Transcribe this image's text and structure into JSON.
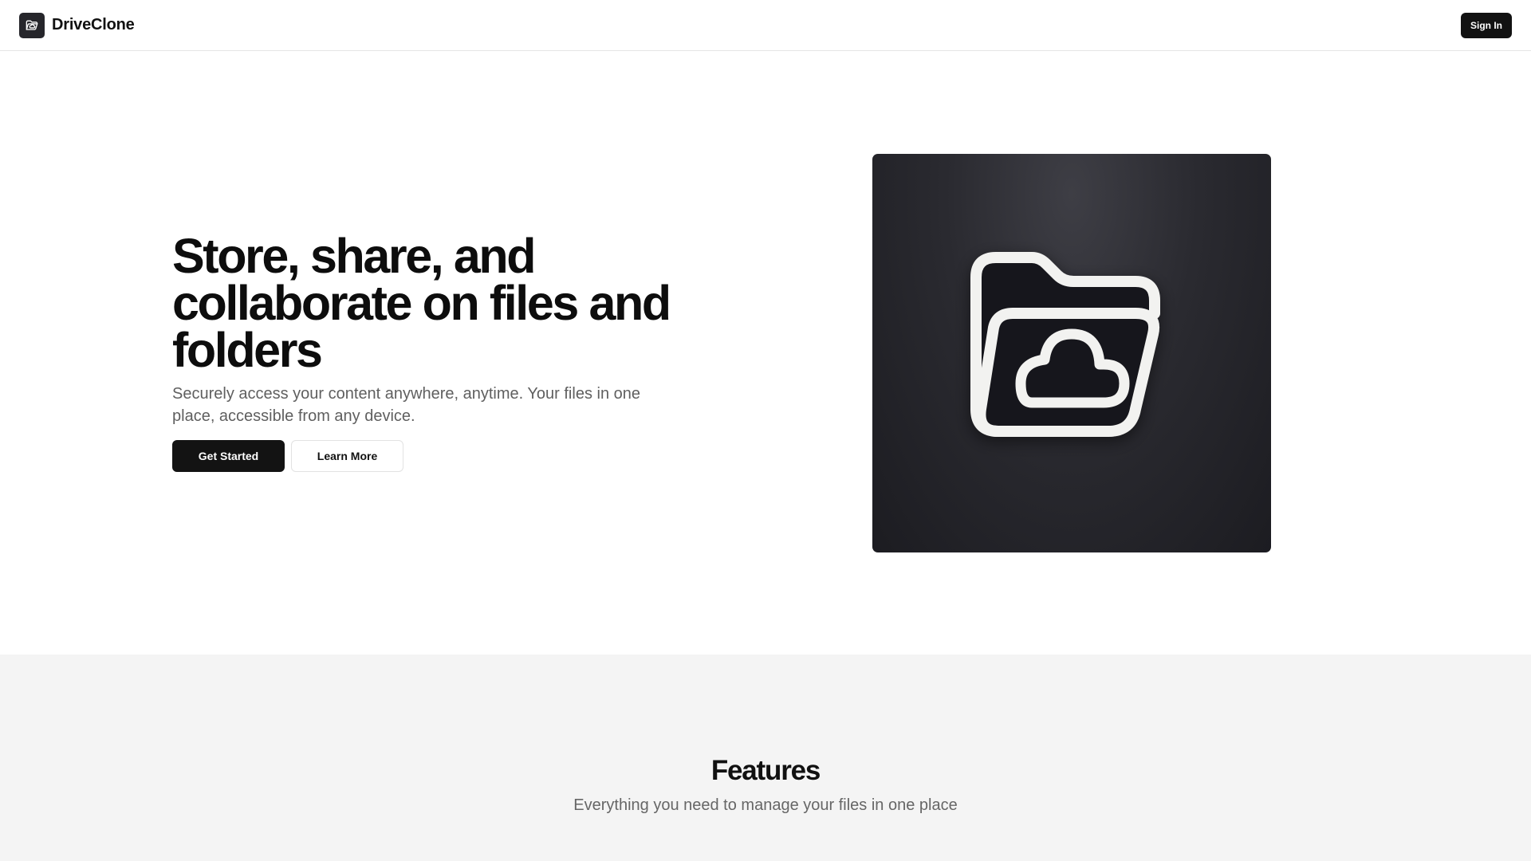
{
  "header": {
    "brand": "DriveClone",
    "brand_icon": "folder-cloud-icon",
    "signin_label": "Sign In"
  },
  "hero": {
    "title": "Store, share, and collaborate on files and folders",
    "subtitle": "Securely access your content anywhere, anytime. Your files in one place, accessible from any device.",
    "primary_cta": "Get Started",
    "secondary_cta": "Learn More",
    "illustration_icon": "folder-cloud-icon"
  },
  "features": {
    "title": "Features",
    "subtitle": "Everything you need to manage your files in one place"
  },
  "colors": {
    "primary": "#131313",
    "muted_text": "#5f5f5f",
    "section_bg": "#f4f4f4",
    "art_bg": "#26262b"
  }
}
